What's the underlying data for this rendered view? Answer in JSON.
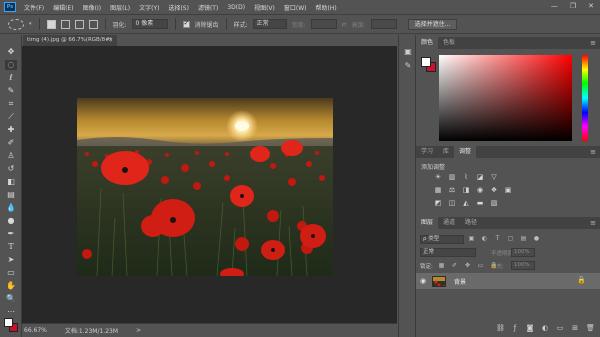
{
  "app": {
    "logo": "Ps",
    "menu": [
      "文件(F)",
      "编辑(E)",
      "图像(I)",
      "图层(L)",
      "文字(Y)",
      "选择(S)",
      "滤镜(T)",
      "3D(D)",
      "视图(V)",
      "窗口(W)",
      "帮助(H)"
    ],
    "window_controls": [
      "—",
      "❐",
      "✕"
    ]
  },
  "options_bar": {
    "feather_label": "羽化:",
    "feather_value": "0 像素",
    "antialias_label": "消除锯齿",
    "style_label": "样式:",
    "style_value": "正常",
    "width_label": "宽度:",
    "height_label": "高度:",
    "swap_icon": "⇄",
    "select_mask_button": "选择并遮住..."
  },
  "document": {
    "tab_title": "timg (4).jpg @ 66.7%(RGB/8#)",
    "tab_close": "×",
    "zoom": "66.67%",
    "doc_info": "文档:1.23M/1.23M",
    "status_arrow": ">"
  },
  "panels": {
    "color_tabs": [
      "颜色",
      "色板"
    ],
    "adjust_tabs": [
      "学习",
      "库",
      "调整"
    ],
    "adjust_title": "添加调整",
    "layers_tabs": [
      "图层",
      "通道",
      "路径"
    ],
    "panel_menu": "≡",
    "layer_filter_label": "ρ 类型",
    "blend_mode": "正常",
    "opacity_label": "不透明度:",
    "opacity_value": "100%",
    "lock_label": "锁定:",
    "fill_label": "填充:",
    "fill_value": "100%",
    "layer_name": "背景",
    "layer_eye": "◉",
    "layer_lock": "🔒"
  },
  "colors": {
    "foreground": "#ffffff",
    "background": "#c8112d",
    "picker_hue": "#ff0000"
  }
}
